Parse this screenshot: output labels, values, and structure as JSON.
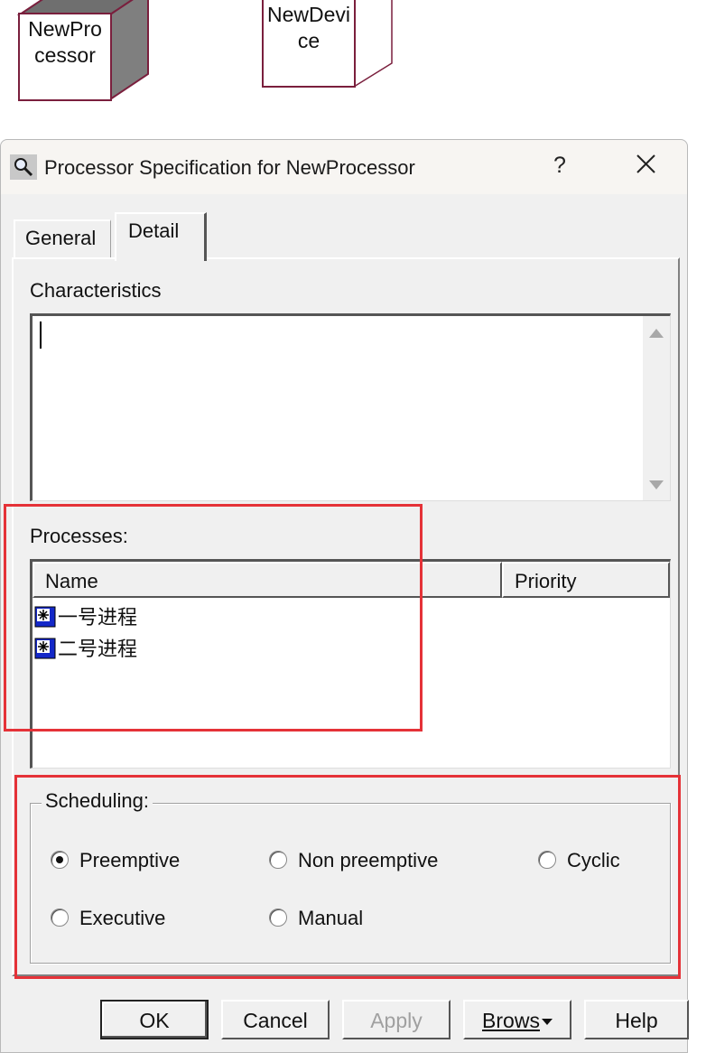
{
  "diagram": {
    "nodes": [
      {
        "label_line1": "NewPro",
        "label_line2": "cessor"
      },
      {
        "label_line1": "NewDevi",
        "label_line2": "ce"
      }
    ]
  },
  "dialog": {
    "title": "Processor Specification for NewProcessor",
    "help_label": "?",
    "close_label": "×",
    "tabs": [
      {
        "label": "General",
        "active": false
      },
      {
        "label": "Detail",
        "active": true
      }
    ],
    "characteristics": {
      "label": "Characteristics",
      "value": ""
    },
    "processes": {
      "label": "Processes:",
      "columns": [
        "Name",
        "Priority"
      ],
      "rows": [
        {
          "name": "一号进程",
          "priority": ""
        },
        {
          "name": "二号进程",
          "priority": ""
        }
      ]
    },
    "scheduling": {
      "label": "Scheduling:",
      "options": [
        "Preemptive",
        "Non preemptive",
        "Cyclic",
        "Executive",
        "Manual"
      ],
      "selected": "Preemptive"
    },
    "buttons": {
      "ok": "OK",
      "cancel": "Cancel",
      "apply": "Apply",
      "browse": "Brows",
      "help": "Help"
    }
  },
  "colors": {
    "annotation_highlight": "#e53238",
    "node_border": "#7a1f3d",
    "dialog_bg": "#f0f0f0"
  }
}
